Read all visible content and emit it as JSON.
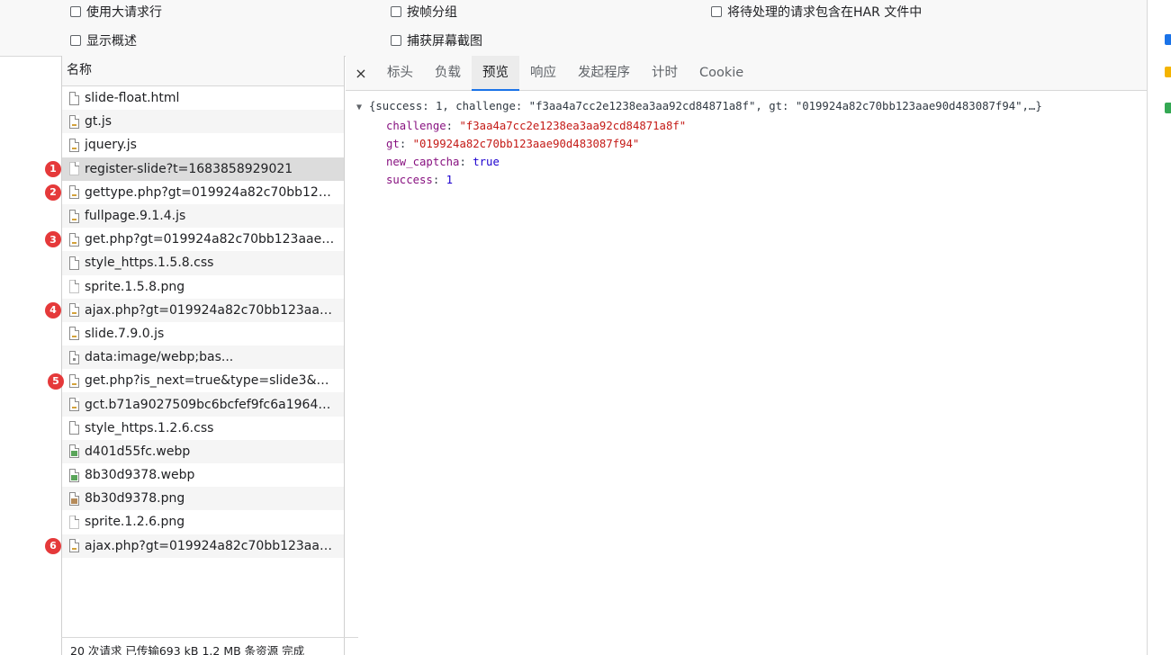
{
  "options": {
    "large_rows": "使用大请求行",
    "group_by_frame": "按帧分组",
    "include_pending_har": "将待处理的请求包含在HAR 文件中",
    "show_overview": "显示概述",
    "capture_screenshots": "捕获屏幕截图"
  },
  "list": {
    "header": "名称",
    "rows": [
      {
        "name": "slide-float.html",
        "icon": "document-icon"
      },
      {
        "name": "gt.js",
        "icon": "script-icon"
      },
      {
        "name": "jquery.js",
        "icon": "script-icon"
      },
      {
        "name": "register-slide?t=1683858929021",
        "icon": "xhr-icon",
        "badge": "1"
      },
      {
        "name": "gettype.php?gt=019924a82c70bb123aa...",
        "icon": "script-icon",
        "badge": "2"
      },
      {
        "name": "fullpage.9.1.4.js",
        "icon": "script-icon"
      },
      {
        "name": "get.php?gt=019924a82c70bb123aae90d...",
        "icon": "script-icon",
        "badge": "3"
      },
      {
        "name": "style_https.1.5.8.css",
        "icon": "stylesheet-icon"
      },
      {
        "name": "sprite.1.5.8.png",
        "icon": "image-icon"
      },
      {
        "name": "ajax.php?gt=019924a82c70bb123aae90...",
        "icon": "script-icon",
        "badge": "4"
      },
      {
        "name": "slide.7.9.0.js",
        "icon": "script-icon"
      },
      {
        "name": "data:image/webp;bas...",
        "icon": "data-icon"
      },
      {
        "name": "get.php?is_next=true&type=slide3&gt=...",
        "icon": "script-icon",
        "badge": "5"
      },
      {
        "name": "gct.b71a9027509bc6bcfef9fc6a196424f5...",
        "icon": "script-icon"
      },
      {
        "name": "style_https.1.2.6.css",
        "icon": "stylesheet-icon"
      },
      {
        "name": "d401d55fc.webp",
        "icon": "webp-image-icon"
      },
      {
        "name": "8b30d9378.webp",
        "icon": "webp-image-icon"
      },
      {
        "name": "8b30d9378.png",
        "icon": "png-image-icon"
      },
      {
        "name": "sprite.1.2.6.png",
        "icon": "image-icon"
      },
      {
        "name": "ajax.php?gt=019924a82c70bb123aae90...",
        "icon": "script-icon",
        "badge": "6"
      }
    ]
  },
  "status_bar": "20 次请求  已传输693 kB  1.2 MB 条资源  完成",
  "tabs": {
    "close": "×",
    "headers": "标头",
    "payload": "负载",
    "preview": "预览",
    "response": "响应",
    "initiator": "发起程序",
    "timing": "计时",
    "cookie": "Cookie"
  },
  "preview": {
    "summary": "{success: 1, challenge: \"f3aa4a7cc2e1238ea3aa92cd84871a8f\", gt: \"019924a82c70bb123aae90d483087f94\",…}",
    "challenge_key": "challenge",
    "challenge_value": "\"f3aa4a7cc2e1238ea3aa92cd84871a8f\"",
    "gt_key": "gt",
    "gt_value": "\"019924a82c70bb123aae90d483087f94\"",
    "new_captcha_key": "new_captcha",
    "new_captcha_value": "true",
    "success_key": "success",
    "success_value": "1"
  },
  "colors": {
    "badge": "#e5393a",
    "tab_active_underline": "#1a73e8",
    "json_key": "#881280",
    "json_string": "#c41a16",
    "json_number": "#1c00cf"
  }
}
